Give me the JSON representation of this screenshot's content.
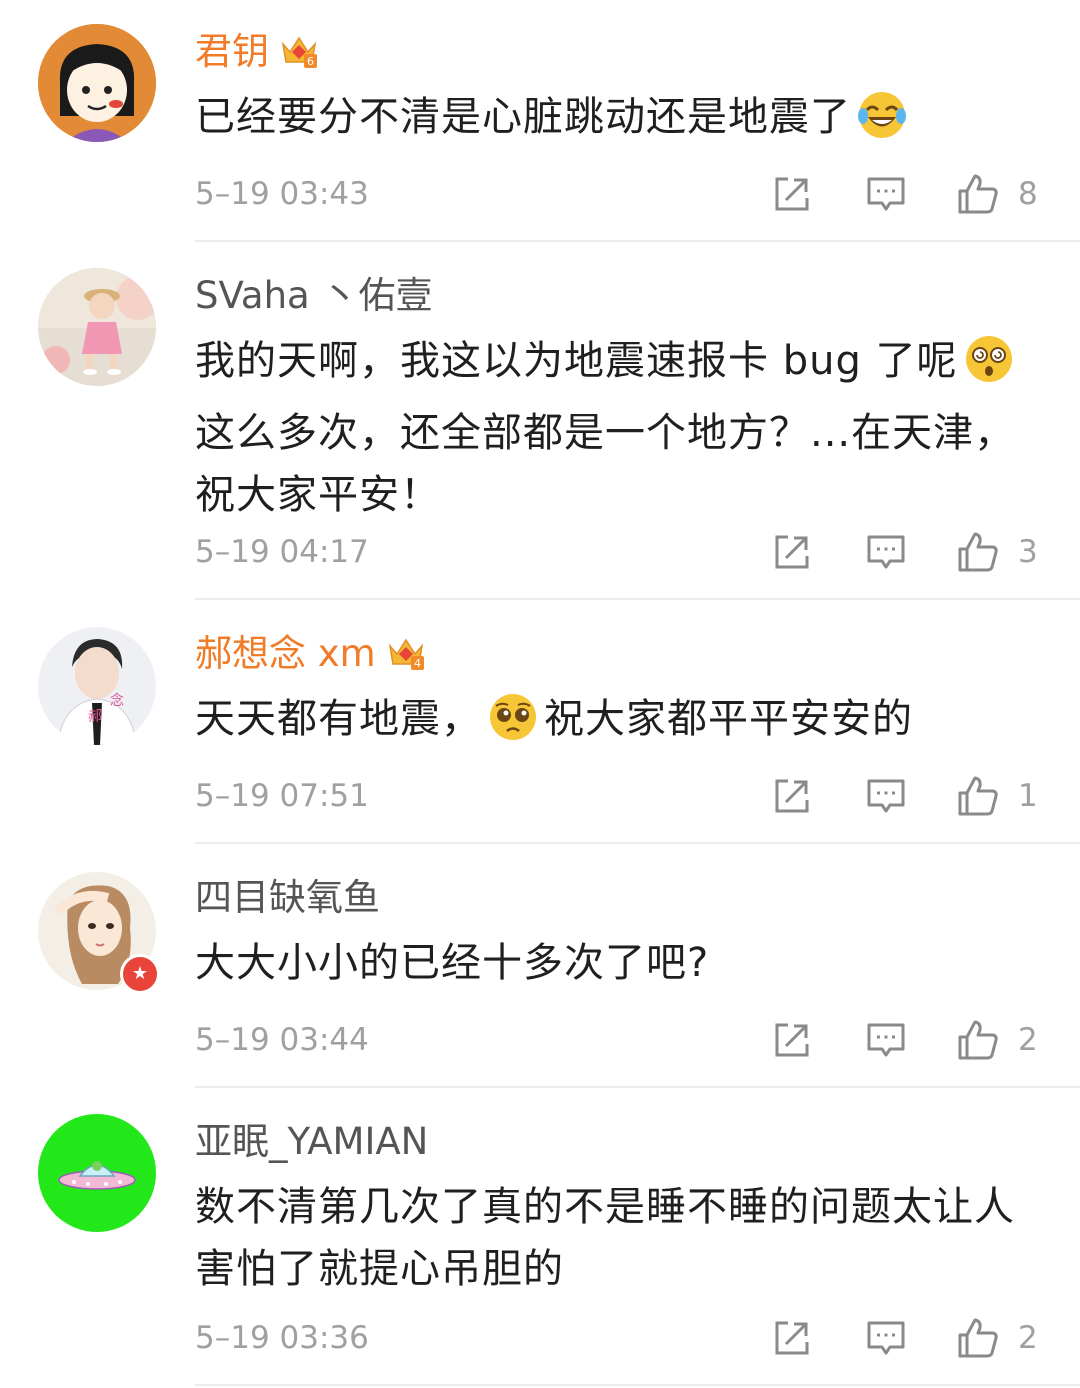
{
  "comments": [
    {
      "user": "君钥",
      "text_before": "已经要分不清是心脏跳动还是地震了",
      "text_after": "",
      "emoji": "laugh-cry-emoji",
      "time": "5–19 03:43",
      "likes": "8",
      "vip_level": "6"
    },
    {
      "user": "SVaha 丶佑壹",
      "text_before": "我的天啊，我这以为地震速报卡 bug 了呢",
      "text_after": "这么多次，还全部都是一个地方？...在天津，祝大家平安！",
      "emoji": "dizzy-face-emoji",
      "time": "5–19 04:17",
      "likes": "3"
    },
    {
      "user": "郝想念 xm",
      "text_before": "天天都有地震，",
      "text_after": "祝大家都平平安安的",
      "emoji": "pleading-face-emoji",
      "time": "5–19 07:51",
      "likes": "1",
      "vip_level": "4"
    },
    {
      "user": "四目缺氧鱼",
      "text_before": "大大小小的已经十多次了吧?",
      "time": "5–19 03:44",
      "likes": "2",
      "badge": "★"
    },
    {
      "user": "亚眠_YAMIAN",
      "text_before": "数不清第几次了真的不是睡不睡的问题太让人害怕了就提心吊胆的",
      "time": "5–19 03:36",
      "likes": "2"
    }
  ],
  "colors": {
    "vip_name": "#f07b28",
    "name": "#555555",
    "time": "#a0a0a0",
    "icon": "#8a8a8a"
  },
  "icons": [
    "share-icon",
    "reply-icon",
    "like-icon",
    "crown-icon"
  ]
}
